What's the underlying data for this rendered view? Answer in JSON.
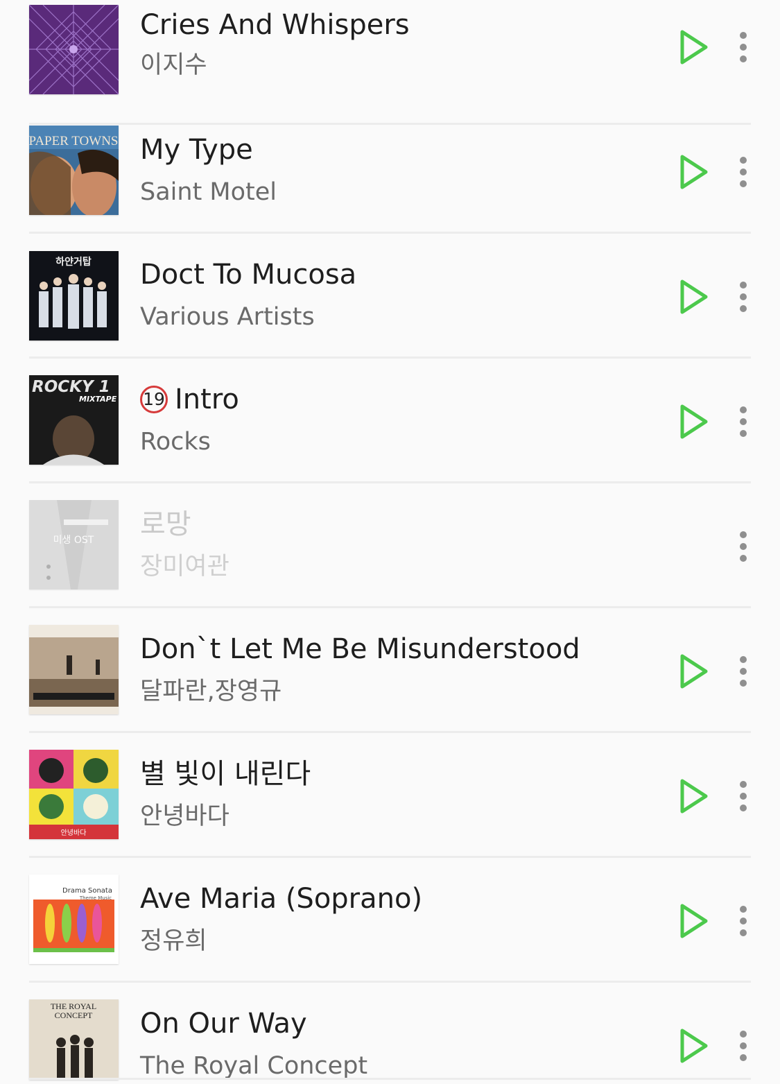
{
  "accent_color": "#4cc94c",
  "songs": [
    {
      "title": "Cries And Whispers",
      "artist": "이지수",
      "art": "purple-pattern-album-art",
      "playable": true
    },
    {
      "title": "My Type",
      "artist": "Saint Motel",
      "art": "paper-towns-album-art",
      "art_text": "PAPER TOWNS",
      "playable": true
    },
    {
      "title": "Doct To Mucosa",
      "artist": "Various Artists",
      "art": "doctors-album-art",
      "art_text": "하얀거탑",
      "playable": true
    },
    {
      "title": "Intro",
      "artist": "Rocks",
      "badge": "19",
      "art": "rocky-mixtape-album-art",
      "art_text": "ROCKY 1",
      "art_subtext": "MIXTAPE",
      "playable": true
    },
    {
      "title": "로망",
      "artist": "장미여관",
      "art": "misaeng-ost-album-art",
      "art_text": "미생 OST",
      "playable": false
    },
    {
      "title": "Don`t Let Me Be Misunderstood",
      "artist": "달파란,장영규",
      "art": "desert-album-art",
      "playable": true
    },
    {
      "title": "별 빛이 내린다",
      "artist": "안녕바다",
      "art": "pop-art-album-art",
      "art_text": "안녕바다",
      "playable": true
    },
    {
      "title": "Ave Maria (Soprano)",
      "artist": "정유희",
      "art": "drama-sonata-album-art",
      "art_text": "Drama Sonata",
      "art_subtext": "Theme Music",
      "playable": true
    },
    {
      "title": "On Our Way",
      "artist": "The Royal Concept",
      "art": "royal-concept-album-art",
      "art_text": "THE ROYAL",
      "art_subtext": "CONCEPT",
      "playable": true
    }
  ]
}
